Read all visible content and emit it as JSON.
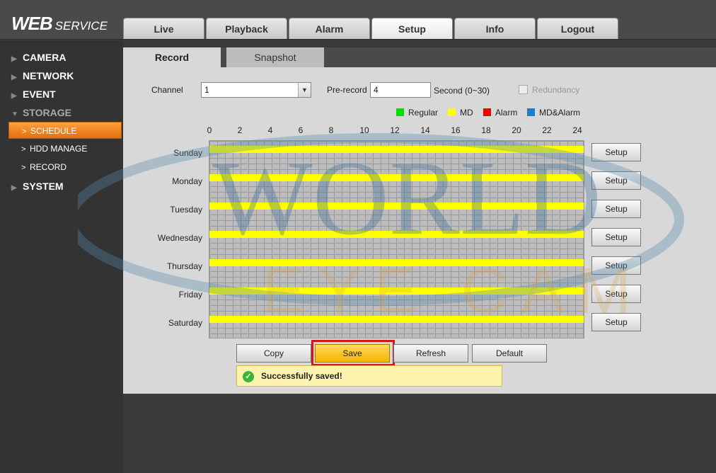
{
  "app": {
    "logo_main": "WEB",
    "logo_sub": "SERVICE"
  },
  "top_tabs": [
    {
      "label": "Live"
    },
    {
      "label": "Playback"
    },
    {
      "label": "Alarm"
    },
    {
      "label": "Setup",
      "active": true
    },
    {
      "label": "Info"
    },
    {
      "label": "Logout"
    }
  ],
  "sidebar": {
    "camera": "CAMERA",
    "network": "NETWORK",
    "event": "EVENT",
    "storage": "STORAGE",
    "schedule": "SCHEDULE",
    "hdd_manage": "HDD MANAGE",
    "record": "RECORD",
    "system": "SYSTEM"
  },
  "sub_tabs": {
    "record": "Record",
    "snapshot": "Snapshot"
  },
  "form": {
    "channel_label": "Channel",
    "channel_value": "1",
    "prerecord_label": "Pre-record",
    "prerecord_value": "4",
    "prerecord_unit": "Second (0~30)",
    "redundancy_label": "Redundancy"
  },
  "legend": [
    {
      "label": "Regular",
      "color": "#00dd00"
    },
    {
      "label": "MD",
      "color": "#ffff00"
    },
    {
      "label": "Alarm",
      "color": "#ee0000"
    },
    {
      "label": "MD&Alarm",
      "color": "#1b7fd1"
    }
  ],
  "hours": [
    "0",
    "2",
    "4",
    "6",
    "8",
    "10",
    "12",
    "14",
    "16",
    "18",
    "20",
    "22",
    "24"
  ],
  "days": [
    "Sunday",
    "Monday",
    "Tuesday",
    "Wednesday",
    "Thursday",
    "Friday",
    "Saturday"
  ],
  "setup_label": "Setup",
  "buttons": {
    "copy": "Copy",
    "save": "Save",
    "refresh": "Refresh",
    "default": "Default"
  },
  "message": "Successfully saved!",
  "watermark": {
    "line1": "WORLD",
    "line2": "EYE CAM"
  }
}
